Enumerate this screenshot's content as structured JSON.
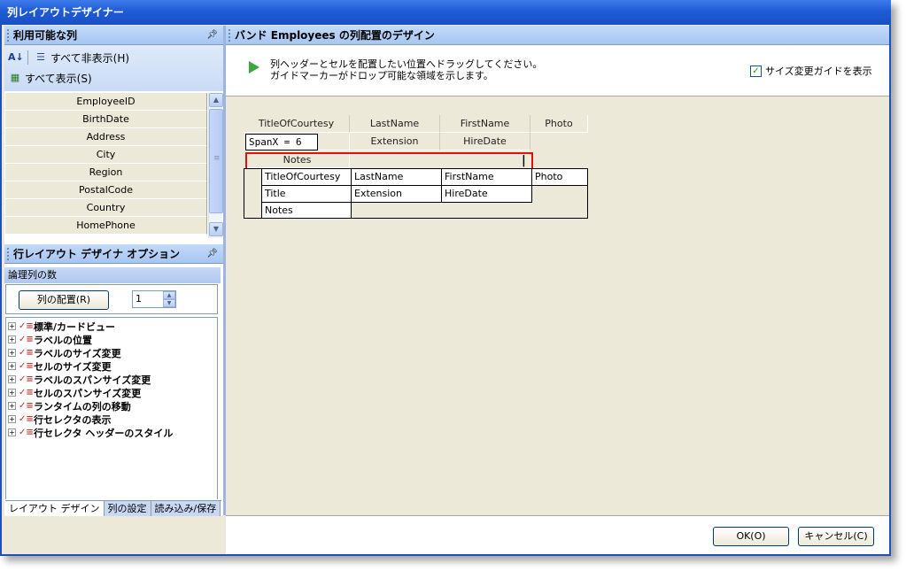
{
  "window": {
    "title": "列レイアウトデザイナー"
  },
  "left_pane": {
    "header": "利用可能な列",
    "pin_icon": "pin-icon",
    "toolbar": {
      "sort_label": "",
      "hide_all": "すべて非表示(H)",
      "show_all": "すべて表示(S)"
    },
    "columns": [
      "EmployeeID",
      "BirthDate",
      "Address",
      "City",
      "Region",
      "PostalCode",
      "Country",
      "HomePhone"
    ]
  },
  "options_pane": {
    "header": "行レイアウト デザイナ オプション",
    "section": "論理列の数",
    "arrange_button": "列の配置(R)",
    "count_value": "1",
    "tree": [
      "標準/カードビュー",
      "ラベルの位置",
      "ラベルのサイズ変更",
      "セルのサイズ変更",
      "ラベルのスパンサイズ変更",
      "セルのスパンサイズ変更",
      "ランタイムの列の移動",
      "行セレクタの表示",
      "行セレクタ ヘッダーのスタイル"
    ]
  },
  "tabs": [
    "レイアウト デザイン",
    "列の設定",
    "読み込み/保存"
  ],
  "design_pane": {
    "header": "バンド Employees の列配置のデザイン",
    "hint_line1": "列ヘッダーとセルを配置したい位置へドラッグしてください。",
    "hint_line2": "ガイドマーカーがドロップ可能な領域を示します。",
    "guide_checkbox_label": "サイズ変更ガイドを表示",
    "guide_checked": true,
    "header_row1": [
      "TitleOfCourtesy",
      "LastName",
      "FirstName",
      "Photo"
    ],
    "header_row2": [
      "Extension",
      "HireDate"
    ],
    "spanx_text": "SpanX = 6",
    "header_row3": "Notes",
    "grid_row1": [
      "TitleOfCourtesy",
      "LastName",
      "FirstName",
      "Photo"
    ],
    "grid_row2": [
      "Title",
      "Extension",
      "HireDate"
    ],
    "grid_row3": "Notes"
  },
  "buttons": {
    "ok": "OK(O)",
    "cancel": "キャンセル(C)"
  }
}
